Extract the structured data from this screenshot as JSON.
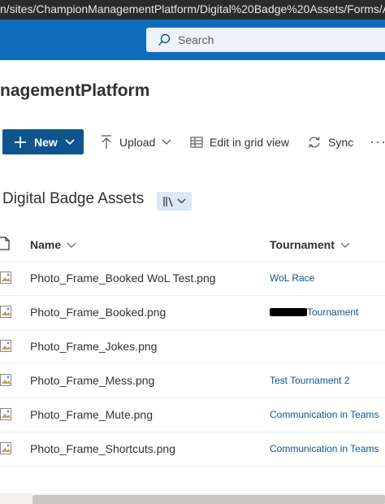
{
  "browser": {
    "url_text": "n/sites/ChampionManagementPlatform/Digital%20Badge%20Assets/Forms/Al"
  },
  "suite_bar": {
    "search_placeholder": "Search"
  },
  "site": {
    "title": "nagementPlatform"
  },
  "command_bar": {
    "new_label": "New",
    "upload_label": "Upload",
    "grid_label": "Edit in grid view",
    "sync_label": "Sync",
    "more_label": "···"
  },
  "library": {
    "title": "Digital Badge Assets"
  },
  "columns": {
    "name": "Name",
    "tournament": "Tournament"
  },
  "files": [
    {
      "name": "Photo_Frame_Booked WoL Test.png",
      "tournament": "WoL Race"
    },
    {
      "name": "Photo_Frame_Booked.png",
      "tournament": "Tournament",
      "tournament_redacted": true
    },
    {
      "name": "Photo_Frame_Jokes.png",
      "tournament": ""
    },
    {
      "name": "Photo_Frame_Mess.png",
      "tournament": "Test Tournament 2"
    },
    {
      "name": "Photo_Frame_Mute.png",
      "tournament": "Communication in Teams"
    },
    {
      "name": "Photo_Frame_Shortcuts.png",
      "tournament": "Communication in Teams"
    }
  ],
  "icons": {
    "search": "search-icon",
    "plus": "plus-icon",
    "chevron": "chevron-down-icon",
    "upload": "upload-icon",
    "grid": "grid-icon",
    "sync": "sync-icon",
    "library_view": "library-view-icon",
    "file_header": "document-icon",
    "file": "image-file-icon"
  },
  "colors": {
    "suite_bar": "#0f6cbd",
    "primary_button": "#0f548c",
    "link": "#0f548c"
  }
}
